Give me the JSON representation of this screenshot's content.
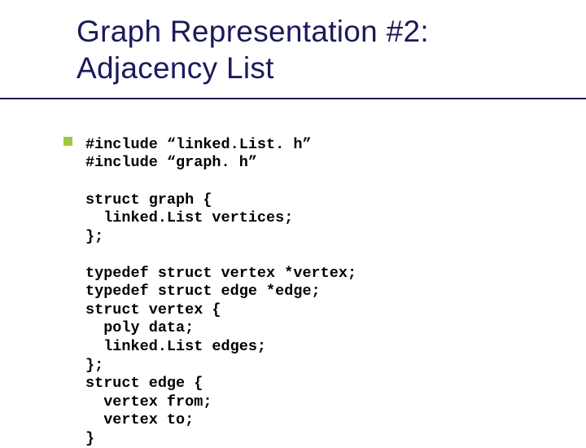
{
  "title": {
    "line1": "Graph Representation #2:",
    "line2": "Adjacency List"
  },
  "code": {
    "l1": "#include “linked.List. h”",
    "l2": "#include “graph. h”",
    "l3": "",
    "l4": "struct graph {",
    "l5": "  linked.List vertices;",
    "l6": "};",
    "l7": "",
    "l8": "typedef struct vertex *vertex;",
    "l9": "typedef struct edge *edge;",
    "l10": "struct vertex {",
    "l11": "  poly data;",
    "l12": "  linked.List edges;",
    "l13": "};",
    "l14": "struct edge {",
    "l15": "  vertex from;",
    "l16": "  vertex to;",
    "l17": "}"
  }
}
